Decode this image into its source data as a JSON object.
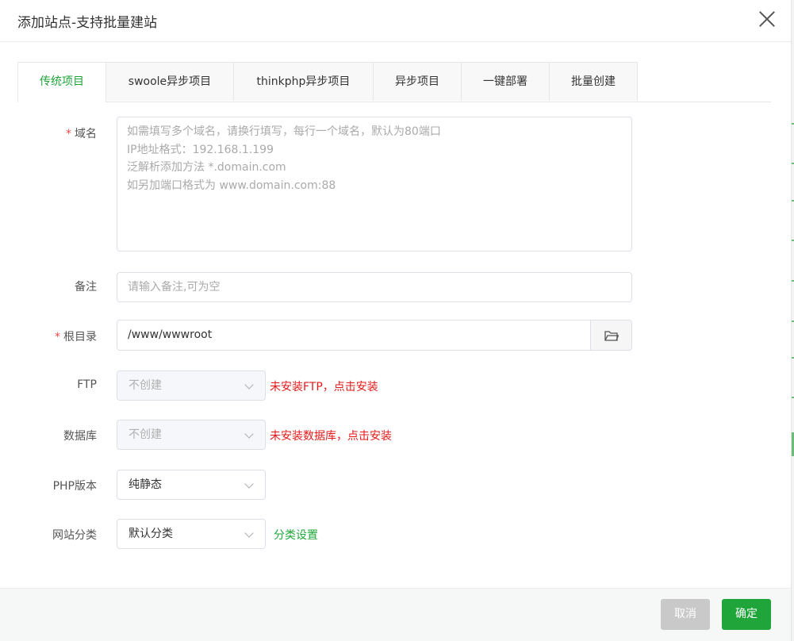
{
  "dialog": {
    "title": "添加站点-支持批量建站"
  },
  "tabs": [
    {
      "label": "传统项目",
      "active": true
    },
    {
      "label": "swoole异步项目"
    },
    {
      "label": "thinkphp异步项目"
    },
    {
      "label": "异步项目"
    },
    {
      "label": "一键部署"
    },
    {
      "label": "批量创建"
    }
  ],
  "form": {
    "domain": {
      "label": "域名",
      "placeholder_lines": [
        "如需填写多个域名，请换行填写，每行一个域名，默认为80端口",
        "IP地址格式：192.168.1.199",
        "泛解析添加方法 *.domain.com",
        "如另加端口格式为 www.domain.com:88"
      ]
    },
    "remark": {
      "label": "备注",
      "placeholder": "请输入备注,可为空"
    },
    "root": {
      "label": "根目录",
      "value": "/www/wwwroot"
    },
    "ftp": {
      "label": "FTP",
      "value": "不创建",
      "warning": "未安装FTP，点击安装"
    },
    "database": {
      "label": "数据库",
      "value": "不创建",
      "warning": "未安装数据库，点击安装"
    },
    "php": {
      "label": "PHP版本",
      "value": "纯静态"
    },
    "category": {
      "label": "网站分类",
      "value": "默认分类",
      "link": "分类设置"
    }
  },
  "footer": {
    "cancel_label": "取消",
    "ok_label": "确定"
  },
  "colors": {
    "accent": "#20a53a",
    "warning": "#e31a1a",
    "cancel_bg": "#c9c9c9"
  }
}
